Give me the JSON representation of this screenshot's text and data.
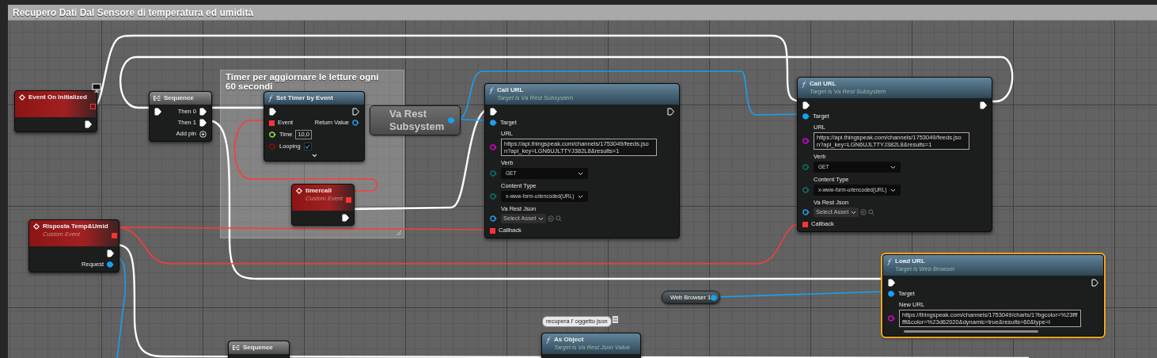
{
  "graph_title": "Recupero Dati Dal Sensore di temperatura ed umidità",
  "comment_box": {
    "text": "Timer per aggiornare le letture ogni 60 secondi"
  },
  "nodes": [
    {
      "kind": "event",
      "title": "Event On Initialized",
      "selected": false,
      "header_pin": {
        "kind": "delegate",
        "connected": false
      },
      "rows": [
        {
          "right": {
            "kind": "exec",
            "connected": true
          }
        }
      ]
    },
    {
      "kind": "sequence",
      "title": "Sequence",
      "selected": false,
      "rows": [
        {
          "left": {
            "kind": "exec",
            "connected": true
          },
          "right": {
            "kind": "exec",
            "label": "Then 0",
            "connected": true
          }
        },
        {
          "right": {
            "kind": "exec",
            "label": "Then 1",
            "connected": true
          }
        },
        {
          "right": {
            "kind": "add",
            "label": "Add pin",
            "connected": false
          }
        }
      ]
    },
    {
      "kind": "function",
      "title": "Set Timer by Event",
      "selected": false,
      "advanced": true,
      "rows": [
        {
          "left": {
            "kind": "exec",
            "connected": true
          },
          "right": {
            "kind": "exec",
            "connected": false
          }
        },
        {
          "left": {
            "kind": "delegate",
            "label": "Event",
            "connected": true
          },
          "right": {
            "kind": "object",
            "label": "Return Value",
            "connected": false
          }
        },
        {
          "left": {
            "kind": "float",
            "label": "Time",
            "value": "10,0",
            "connected": false
          }
        },
        {
          "left": {
            "kind": "bool",
            "label": "Looping",
            "checked": true,
            "connected": false
          }
        }
      ]
    },
    {
      "kind": "getter",
      "title": "Va Rest Subsystem",
      "selected": false,
      "rows": [
        {
          "right": {
            "kind": "object",
            "connected": true
          }
        }
      ]
    },
    {
      "kind": "event",
      "title": "timercall",
      "subtitle": "Custom Event",
      "selected": false,
      "header_pin": {
        "kind": "delegate",
        "connected": true
      },
      "rows": [
        {
          "right": {
            "kind": "exec",
            "connected": true
          }
        }
      ]
    },
    {
      "kind": "function",
      "title": "Call URL",
      "subtitle": "Target is Va Rest Subsystem",
      "selected": false,
      "rows": [
        {
          "left": {
            "kind": "exec",
            "connected": true
          },
          "right": {
            "kind": "exec",
            "connected": false
          }
        },
        {
          "left": {
            "kind": "object",
            "label": "Target",
            "connected": true
          }
        },
        {
          "left": {
            "kind": "string",
            "label": "URL",
            "value": "https://api.thingspeak.com/channels/1753049/feeds.json?api_key=LGN6UJLTTYJ382L8&results=1",
            "connected": false
          }
        },
        {
          "left": {
            "kind": "enum",
            "label": "Verb",
            "value": "GET",
            "connected": false
          }
        },
        {
          "left": {
            "kind": "enum",
            "label": "Content Type",
            "value": "x-www-form-urlencoded(URL)",
            "connected": false
          }
        },
        {
          "left": {
            "kind": "asset",
            "label": "Va Rest Json",
            "value": "Select Asset",
            "connected": false
          }
        },
        {
          "left": {
            "kind": "delegate",
            "label": "Callback",
            "connected": true
          }
        }
      ]
    },
    {
      "kind": "function",
      "title": "Call URL",
      "subtitle": "Target is Va Rest Subsystem",
      "selected": false,
      "rows": [
        {
          "left": {
            "kind": "exec",
            "connected": true
          },
          "right": {
            "kind": "exec",
            "connected": true
          }
        },
        {
          "left": {
            "kind": "object",
            "label": "Target",
            "connected": true
          }
        },
        {
          "left": {
            "kind": "string",
            "label": "URL",
            "value": "https://api.thingspeak.com/channels/1753049/feeds.json?api_key=LGN6UJLTTYJ382L8&results=1",
            "connected": false
          }
        },
        {
          "left": {
            "kind": "enum",
            "label": "Verb",
            "value": "GET",
            "connected": false
          }
        },
        {
          "left": {
            "kind": "enum",
            "label": "Content Type",
            "value": "x-www-form-urlencoded(URL)",
            "connected": false
          }
        },
        {
          "left": {
            "kind": "asset",
            "label": "Va Rest Json",
            "value": "Select Asset",
            "connected": false
          }
        },
        {
          "left": {
            "kind": "delegate",
            "label": "Callback",
            "connected": true
          }
        }
      ]
    },
    {
      "kind": "event",
      "title": "Risposta Temp&Umid",
      "subtitle": "Custom Event",
      "selected": false,
      "header_pin": {
        "kind": "delegate",
        "connected": true
      },
      "rows": [
        {
          "right": {
            "kind": "exec",
            "connected": true
          }
        },
        {
          "right": {
            "kind": "object",
            "label": "Request",
            "connected": true
          }
        }
      ]
    },
    {
      "kind": "function",
      "title": "Load URL",
      "subtitle": "Target is Web Browser",
      "selected": true,
      "rows": [
        {
          "left": {
            "kind": "exec",
            "connected": true
          },
          "right": {
            "kind": "exec",
            "connected": false
          }
        },
        {
          "left": {
            "kind": "object",
            "label": "Target",
            "connected": true
          }
        },
        {
          "left": {
            "kind": "string",
            "label": "New URL",
            "value": "https://thingspeak.com/channels/1753049/charts/1?bgcolor=%23ffffff&color=%23d62020&dynamic=true&results=60&type=l",
            "connected": false
          }
        }
      ]
    },
    {
      "kind": "variable",
      "title": "Web Browser 1",
      "selected": false,
      "rows": [
        {
          "right": {
            "kind": "object",
            "connected": true
          }
        }
      ]
    },
    {
      "kind": "sequence",
      "title": "Sequence",
      "selected": false
    },
    {
      "kind": "function",
      "title": "As Object",
      "subtitle": "Target is Va Rest Json Value",
      "selected": false,
      "bubble": "recupera l' oggetto json"
    }
  ]
}
